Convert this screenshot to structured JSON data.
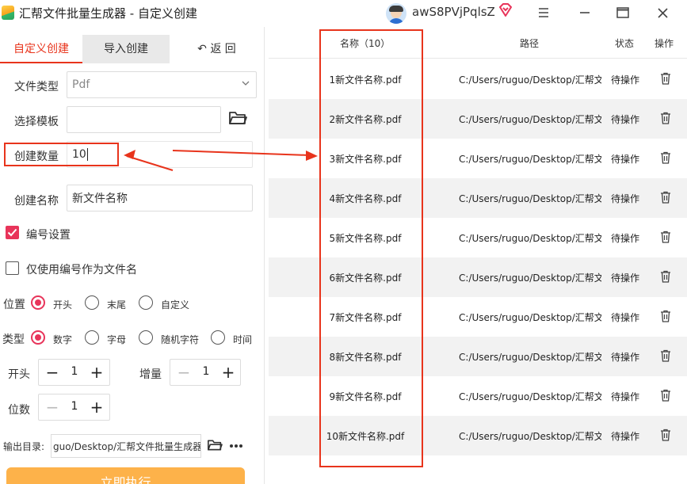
{
  "window": {
    "title": "汇帮文件批量生成器 - 自定义创建",
    "username": "awS8PVjPqlsZ"
  },
  "tabs": {
    "custom": "自定义创建",
    "import": "导入创建",
    "back": "↶ 返   回"
  },
  "form": {
    "file_type_label": "文件类型",
    "file_type_value": "Pdf",
    "template_label": "选择模板",
    "template_value": "",
    "count_label": "创建数量",
    "count_value": "10",
    "name_label": "创建名称",
    "name_value": "新文件名称",
    "numbering_label": "编号设置",
    "numbering_checked": true,
    "only_number_label": "仅使用编号作为文件名",
    "only_number_checked": false,
    "position_label": "位置",
    "position_options": [
      "开头",
      "末尾",
      "自定义"
    ],
    "position_selected": "开头",
    "type_label": "类型",
    "type_options": [
      "数字",
      "字母",
      "随机字符",
      "时间"
    ],
    "type_selected": "数字",
    "start_label": "开头",
    "start_value": "1",
    "increment_label": "增量",
    "increment_value": "1",
    "digits_label": "位数",
    "digits_value": "1",
    "output_label": "输出目录:",
    "output_value": "guo/Desktop/汇帮文件批量生成器",
    "run_label": "立即执行"
  },
  "table": {
    "headers": {
      "name": "名称（10）",
      "path": "路径",
      "state": "状态",
      "action": "操作"
    },
    "rows": [
      {
        "name": "1新文件名称.pdf",
        "path": "C:/Users/ruguo/Desktop/汇帮文",
        "state": "待操作"
      },
      {
        "name": "2新文件名称.pdf",
        "path": "C:/Users/ruguo/Desktop/汇帮文",
        "state": "待操作"
      },
      {
        "name": "3新文件名称.pdf",
        "path": "C:/Users/ruguo/Desktop/汇帮文",
        "state": "待操作"
      },
      {
        "name": "4新文件名称.pdf",
        "path": "C:/Users/ruguo/Desktop/汇帮文",
        "state": "待操作"
      },
      {
        "name": "5新文件名称.pdf",
        "path": "C:/Users/ruguo/Desktop/汇帮文",
        "state": "待操作"
      },
      {
        "name": "6新文件名称.pdf",
        "path": "C:/Users/ruguo/Desktop/汇帮文",
        "state": "待操作"
      },
      {
        "name": "7新文件名称.pdf",
        "path": "C:/Users/ruguo/Desktop/汇帮文",
        "state": "待操作"
      },
      {
        "name": "8新文件名称.pdf",
        "path": "C:/Users/ruguo/Desktop/汇帮文",
        "state": "待操作"
      },
      {
        "name": "9新文件名称.pdf",
        "path": "C:/Users/ruguo/Desktop/汇帮文",
        "state": "待操作"
      },
      {
        "name": "10新文件名称.pdf",
        "path": "C:/Users/ruguo/Desktop/汇帮文",
        "state": "待操作"
      }
    ]
  },
  "icons": {
    "logo": "app-logo-icon",
    "avatar": "avatar",
    "vip": "diamond-icon",
    "menu": "menu-icon",
    "minimize": "minimize-icon",
    "maximize": "maximize-icon",
    "close": "close-icon",
    "folder": "folder-icon",
    "more": "more-icon",
    "delete": "trash-icon"
  },
  "colors": {
    "accent": "#e8341c",
    "checkbox": "#e8345a",
    "run_button": "#fdb24a",
    "row_alt": "#f2f2f2"
  }
}
